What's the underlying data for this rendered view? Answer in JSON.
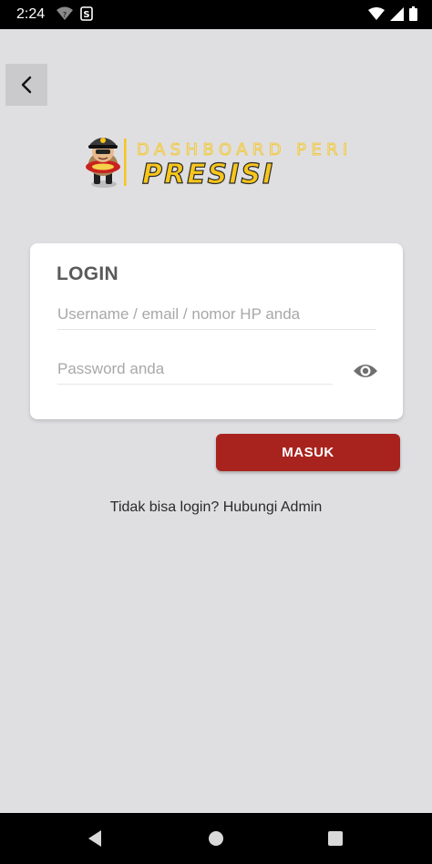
{
  "status_bar": {
    "time": "2:24",
    "icons": [
      "wifi-question-icon",
      "s-app-icon",
      "wifi-icon",
      "signal-icon",
      "battery-icon"
    ]
  },
  "header": {
    "back_icon": "chevron-left-icon"
  },
  "logo": {
    "subtitle": "DASHBOARD PERINTIS",
    "title": "PRESISI",
    "colors": {
      "yellow": "#f7c51b",
      "outline": "#2b2b2b"
    }
  },
  "login": {
    "title": "LOGIN",
    "username_placeholder": "Username / email / nomor HP anda",
    "password_placeholder": "Password anda",
    "toggle_icon": "eye-icon",
    "submit_label": "MASUK",
    "help_text": "Tidak bisa login? Hubungi Admin"
  },
  "colors": {
    "background": "#dfdfe2",
    "button": "#a8231e",
    "card": "#ffffff"
  },
  "nav_bar": {
    "icons": [
      "nav-back-icon",
      "nav-home-icon",
      "nav-recents-icon"
    ]
  }
}
